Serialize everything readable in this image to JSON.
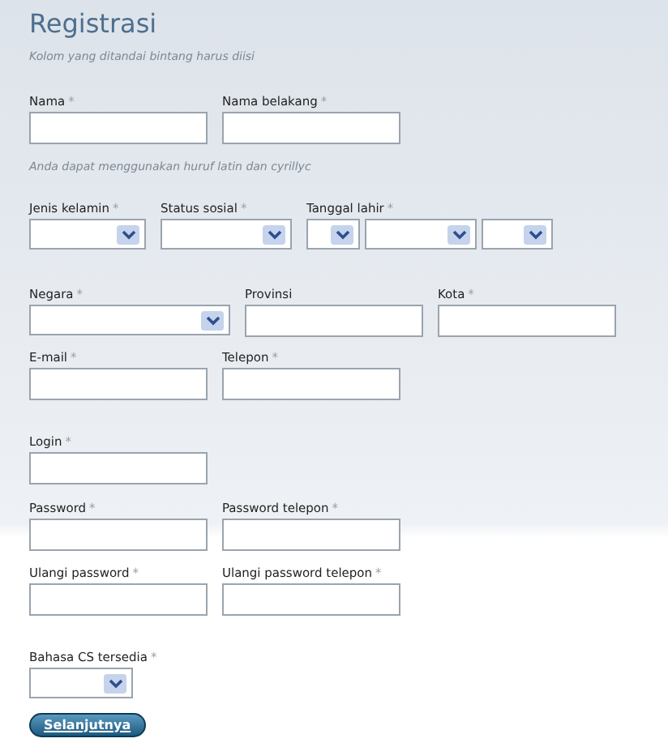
{
  "title": "Registrasi",
  "note": "Kolom yang ditandai bintang harus diisi",
  "sections": [
    {
      "kind": "row",
      "fields": [
        {
          "label": "Nama",
          "mark": "*",
          "controls": [
            {
              "kind": "text"
            }
          ]
        },
        {
          "label": "Nama belakang",
          "mark": "*",
          "controls": [
            {
              "kind": "text"
            }
          ]
        }
      ]
    },
    {
      "kind": "hint",
      "text": "Anda dapat menggunakan huruf latin dan cyrillyc"
    },
    {
      "kind": "row",
      "fields": [
        {
          "label": "Jenis kelamin",
          "mark": "*",
          "controls": [
            {
              "kind": "select"
            }
          ]
        },
        {
          "label": "Status sosial",
          "mark": "*",
          "controls": [
            {
              "kind": "select"
            }
          ]
        },
        {
          "label": "Tanggal lahir",
          "mark": "*",
          "controls": [
            {
              "kind": "select"
            },
            {
              "kind": "select"
            },
            {
              "kind": "select"
            }
          ]
        }
      ]
    },
    {
      "kind": "row",
      "fields": [
        {
          "label": "Negara",
          "mark": "*",
          "controls": [
            {
              "kind": "select"
            }
          ]
        },
        {
          "label": "Provinsi",
          "controls": [
            {
              "kind": "text"
            }
          ]
        },
        {
          "label": "Kota",
          "mark": "*",
          "controls": [
            {
              "kind": "text"
            }
          ]
        }
      ]
    },
    {
      "kind": "row",
      "fields": [
        {
          "label": "E-mail",
          "mark": "*",
          "controls": [
            {
              "kind": "text"
            }
          ]
        },
        {
          "label": "Telepon",
          "mark": "*",
          "controls": [
            {
              "kind": "text"
            }
          ]
        }
      ]
    },
    {
      "kind": "row",
      "fields": [
        {
          "label": "Login",
          "mark": "*",
          "controls": [
            {
              "kind": "text"
            }
          ]
        }
      ]
    },
    {
      "kind": "row",
      "fields": [
        {
          "label": "Password",
          "mark": "*",
          "controls": [
            {
              "kind": "text"
            }
          ]
        },
        {
          "label": "Password telepon",
          "mark": "*",
          "controls": [
            {
              "kind": "text"
            }
          ]
        }
      ]
    },
    {
      "kind": "row",
      "fields": [
        {
          "label": "Ulangi password",
          "mark": "*",
          "controls": [
            {
              "kind": "text"
            }
          ]
        },
        {
          "label": "Ulangi password telepon",
          "mark": "*",
          "controls": [
            {
              "kind": "text"
            }
          ]
        }
      ]
    },
    {
      "kind": "row",
      "fields": [
        {
          "label": "Bahasa CS tersedia",
          "mark": "*",
          "controls": [
            {
              "kind": "select"
            }
          ]
        }
      ]
    }
  ],
  "button": "Selanjutnya"
}
